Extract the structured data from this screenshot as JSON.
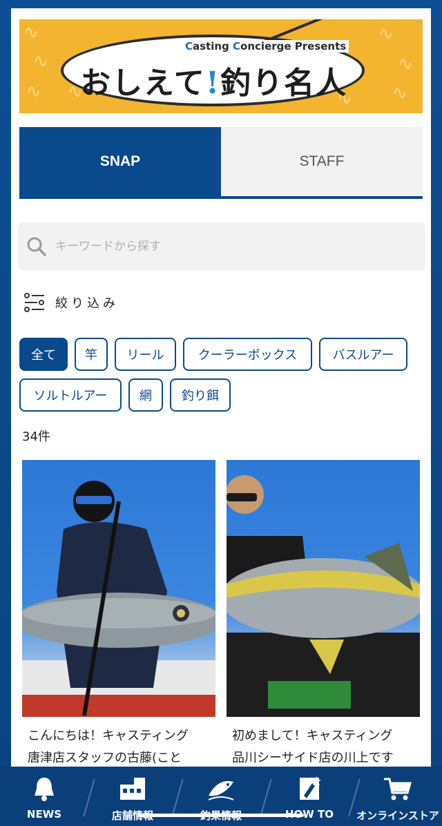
{
  "banner": {
    "presents_prefix": "C",
    "presents_rest_1": "asting ",
    "presents_c2": "C",
    "presents_rest_2": "oncierge Presents",
    "title_1": "おしえて",
    "title_mark": "!",
    "title_2": "釣り名人"
  },
  "tabs": [
    {
      "label": "SNAP",
      "active": true
    },
    {
      "label": "STAFF",
      "active": false
    }
  ],
  "search": {
    "placeholder": "キーワードから探す"
  },
  "filter": {
    "label": "絞り込み"
  },
  "chips": [
    {
      "label": "全て",
      "active": true
    },
    {
      "label": "竿"
    },
    {
      "label": "リール"
    },
    {
      "label": "クーラーボックス"
    },
    {
      "label": "バスルアー"
    },
    {
      "label": "ソルトルアー"
    },
    {
      "label": "網"
    },
    {
      "label": "釣り餌"
    }
  ],
  "result_count": "34件",
  "cards": [
    {
      "line1": "こんにちは！キャスティング",
      "line2": "唐津店スタッフの古藤(こと"
    },
    {
      "line1": "初めまして！キャスティング",
      "line2": "品川シーサイド店の川上です"
    }
  ],
  "bottom_nav": [
    {
      "label": "NEWS",
      "icon": "bell-icon"
    },
    {
      "label": "店舗情報",
      "icon": "store-icon"
    },
    {
      "label": "釣果情報",
      "icon": "fish-icon"
    },
    {
      "label": "HOW TO",
      "icon": "star-book-icon"
    },
    {
      "label": "オンラインストア",
      "icon": "cart-icon"
    }
  ],
  "colors": {
    "primary": "#0a4a8c",
    "banner_bg": "#f3b52f"
  }
}
